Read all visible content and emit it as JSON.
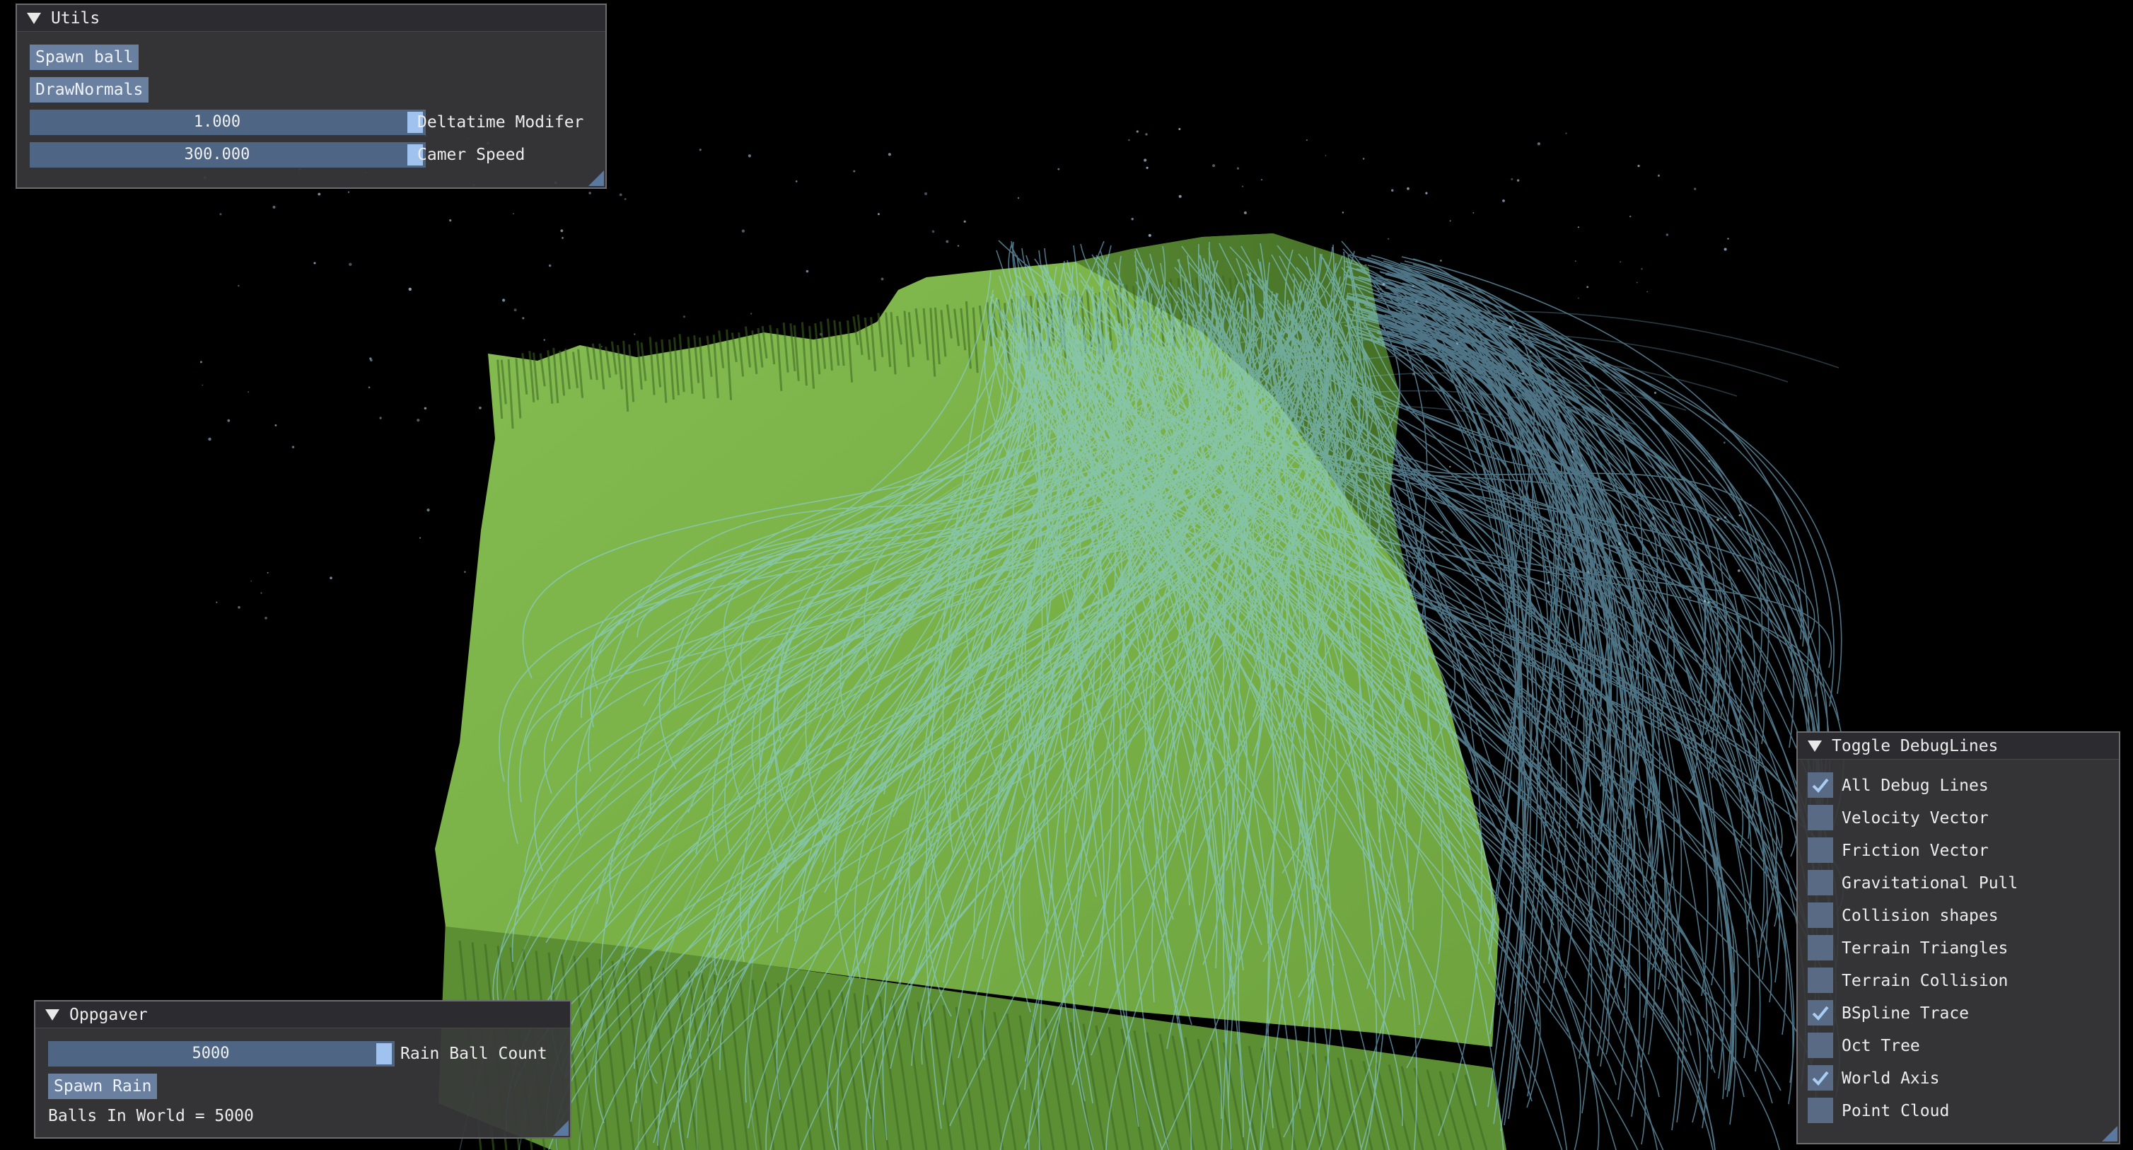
{
  "colors": {
    "background": "#000000",
    "terrain": "#7ab24a",
    "terrain_shadow": "#3f6a24",
    "trace": "#8fd4f2",
    "button": "#6a80a0",
    "slider": "#4e6684",
    "checkbox": "#596a85",
    "window_bg": "#38383a"
  },
  "utils": {
    "title": "Utils",
    "spawn_ball": "Spawn ball",
    "draw_normals": "DrawNormals",
    "deltatime_value": "1.000",
    "deltatime_label": "Deltatime Modifer",
    "camera_speed_value": "300.000",
    "camera_speed_label": "Camer Speed"
  },
  "oppgaver": {
    "title": "Oppgaver",
    "rain_count_value": "5000",
    "rain_count_label": "Rain Ball Count",
    "spawn_rain": "Spawn Rain",
    "balls_in_world": "Balls In World = 5000"
  },
  "debug": {
    "title": "Toggle DebugLines",
    "items": [
      {
        "label": "All Debug Lines",
        "checked": true
      },
      {
        "label": "Velocity Vector",
        "checked": false
      },
      {
        "label": "Friction Vector",
        "checked": false
      },
      {
        "label": "Gravitational Pull",
        "checked": false
      },
      {
        "label": "Collision shapes",
        "checked": false
      },
      {
        "label": "Terrain Triangles",
        "checked": false
      },
      {
        "label": "Terrain Collision",
        "checked": false
      },
      {
        "label": "BSpline Trace",
        "checked": true
      },
      {
        "label": "Oct Tree",
        "checked": false
      },
      {
        "label": "World Axis",
        "checked": true
      },
      {
        "label": "Point Cloud",
        "checked": false
      }
    ]
  }
}
